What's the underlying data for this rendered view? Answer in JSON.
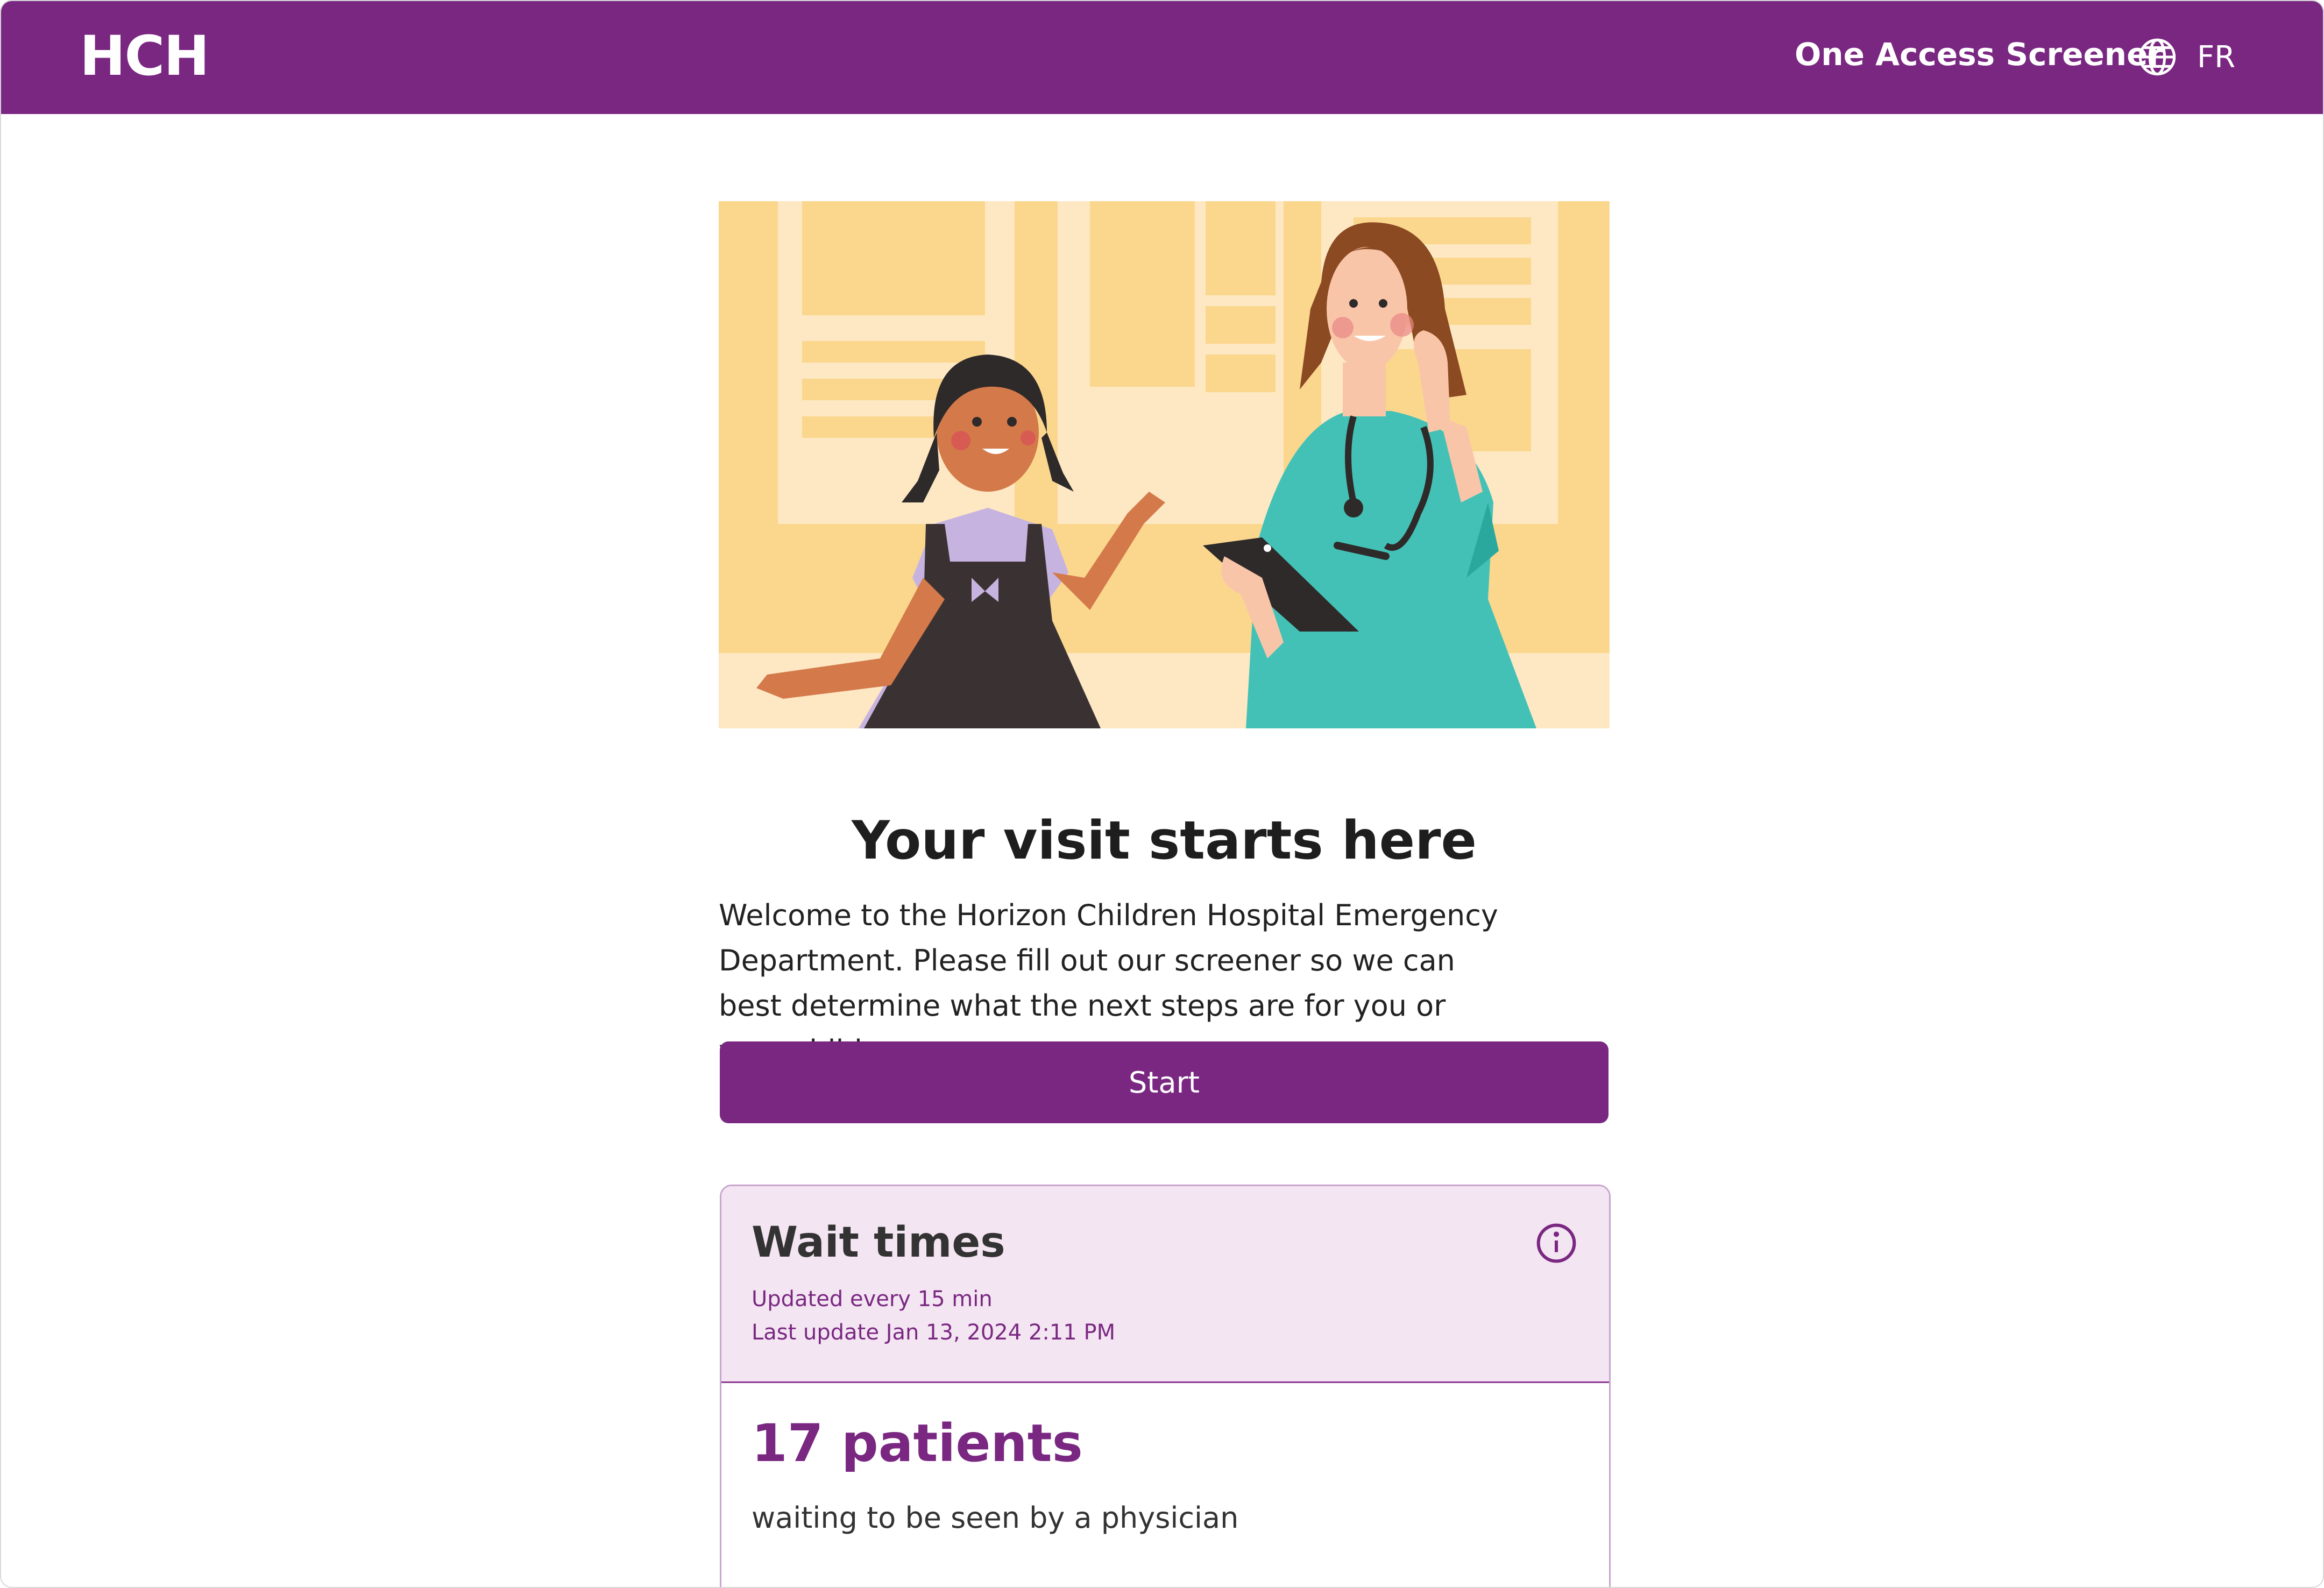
{
  "header": {
    "logo": "HCH",
    "app_title": "One Access Screener",
    "language_toggle": "FR",
    "language_icon": "globe-icon"
  },
  "hero": {
    "illustration": "child-and-nurse-illustration"
  },
  "main": {
    "title": "Your visit starts here",
    "description": "Welcome to the Horizon Children Hospital Emergency Department. Please fill out our screener so we can best determine what the next steps are for you or your child.",
    "start_label": "Start"
  },
  "wait_times": {
    "title": "Wait times",
    "info_icon": "info-icon",
    "update_frequency": "Updated every 15 min",
    "last_update": "Last update Jan 13, 2024 2:11 PM",
    "patients_count": "17 patients",
    "patients_description": "waiting to be seen by a physician"
  },
  "colors": {
    "brand_purple": "#7a2782",
    "card_header_bg": "#f3e5f1",
    "hero_bg": "#fbd78e"
  }
}
